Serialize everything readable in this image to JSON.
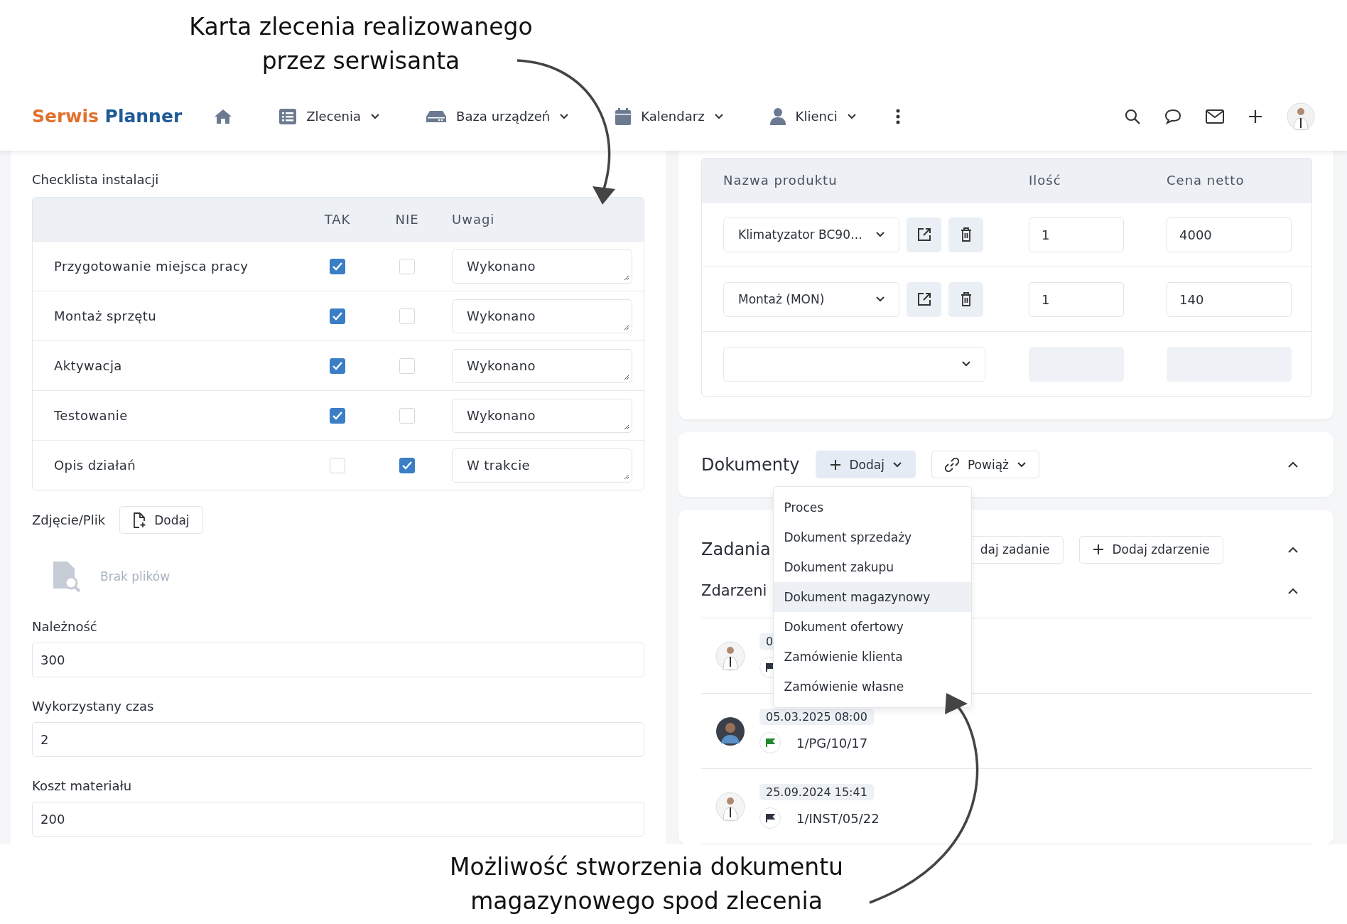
{
  "top_caption": {
    "lines": [
      "Karta zlecenia realizowanego",
      "przez serwisanta"
    ]
  },
  "navbar": {
    "logo": {
      "first": "Serwis",
      "second": "Planner"
    },
    "items": [
      {
        "label": "Zlecenia"
      },
      {
        "label": "Baza urządzeń"
      },
      {
        "label": "Kalendarz"
      },
      {
        "label": "Klienci"
      }
    ]
  },
  "checklist": {
    "title": "Checklista instalacji",
    "columns": [
      "TAK",
      "NIE",
      "Uwagi"
    ],
    "rows": [
      {
        "label": "Przygotowanie miejsca pracy",
        "yes": true,
        "no": false,
        "note": "Wykonano"
      },
      {
        "label": "Montaż sprzętu",
        "yes": true,
        "no": false,
        "note": "Wykonano"
      },
      {
        "label": "Aktywacja",
        "yes": true,
        "no": false,
        "note": "Wykonano"
      },
      {
        "label": "Testowanie",
        "yes": true,
        "no": false,
        "note": "Wykonano"
      },
      {
        "label": "Opis działań",
        "yes": false,
        "no": true,
        "note": "W trakcie"
      }
    ]
  },
  "attachments": {
    "label": "Zdjęcie/Plik",
    "button": "Dodaj",
    "empty": "Brak plików"
  },
  "fields": [
    {
      "label": "Należność",
      "value": "300"
    },
    {
      "label": "Wykorzystany czas",
      "value": "2"
    },
    {
      "label": "Koszt materiału",
      "value": "200"
    }
  ],
  "products": {
    "columns": [
      "Nazwa produktu",
      "Ilość",
      "Cena netto"
    ],
    "rows": [
      {
        "kind": "item",
        "product": "Klimatyzator BC90…",
        "qty": "1",
        "price": "4000"
      },
      {
        "kind": "item",
        "product": "Montaż (MON)",
        "qty": "1",
        "price": "140"
      },
      {
        "kind": "empty"
      }
    ]
  },
  "documents": {
    "title": "Dokumenty",
    "add": "Dodaj",
    "link": "Powiąż",
    "menu": [
      {
        "label": "Proces",
        "selected": false
      },
      {
        "label": "Dokument sprzedaży",
        "selected": false
      },
      {
        "label": "Dokument zakupu",
        "selected": false
      },
      {
        "label": "Dokument magazynowy",
        "selected": true
      },
      {
        "label": "Dokument ofertowy",
        "selected": false
      },
      {
        "label": "Zamówienie klienta",
        "selected": false
      },
      {
        "label": "Zamówienie własne",
        "selected": false
      }
    ]
  },
  "tasks": {
    "title": "Zadania",
    "buttons": [
      "daj zadanie",
      "Dodaj zdarzenie"
    ],
    "events_title": "Zdarzeni",
    "events": [
      {
        "kind": "light",
        "date": "0",
        "color": "#2c3440"
      },
      {
        "kind": "dark",
        "date": "05.03.2025 08:00",
        "code": "1/PG/10/17",
        "color": "#1f8a2e"
      },
      {
        "kind": "light",
        "date": "25.09.2024 15:41",
        "code": "1/INST/05/22",
        "color": "#2c3440"
      }
    ]
  },
  "bottom_caption": {
    "lines": [
      "Możliwość stworzenia dokumentu",
      "magazynowego spod zlecenia"
    ]
  }
}
